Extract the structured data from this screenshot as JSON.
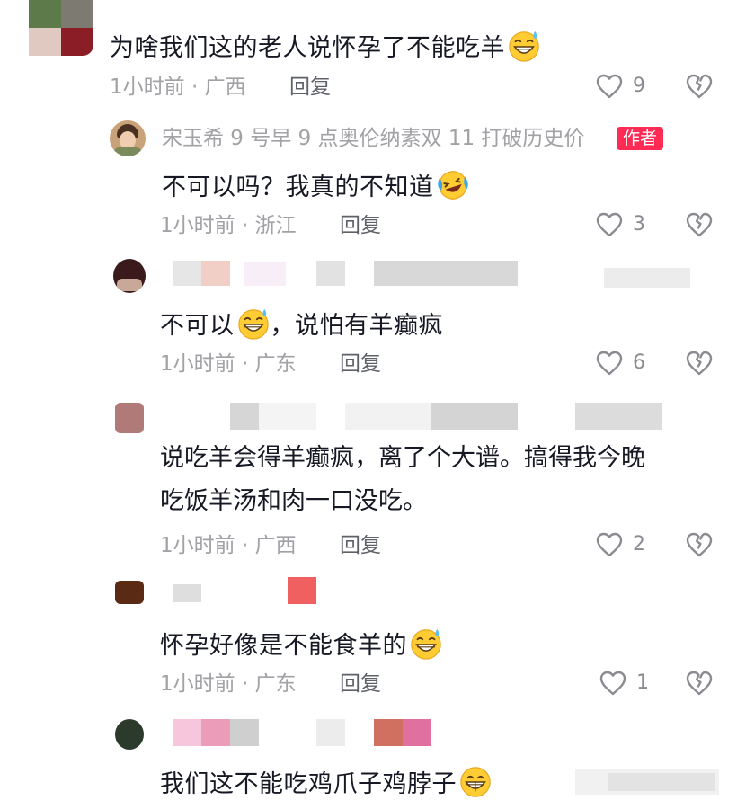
{
  "comments": [
    {
      "text": "为啥我们这的老人说怀孕了不能吃羊",
      "emoji": "grin-sweat-emoji",
      "meta": "1小时前 · 广西",
      "reply_label": "回复",
      "likes": "9"
    },
    {
      "author": "宋玉希 9 号早 9 点奥伦纳素双 11 打破历史价",
      "author_badge": "作者",
      "text": "不可以吗？我真的不知道",
      "emoji": "laugh-cry-emoji",
      "meta": "1小时前 · 浙江",
      "reply_label": "回复",
      "likes": "3"
    },
    {
      "text_before": "不可以",
      "emoji": "grin-sweat-emoji",
      "text_after": "，说怕有羊癫疯",
      "meta": "1小时前 · 广东",
      "reply_label": "回复",
      "likes": "6"
    },
    {
      "line1": "说吃羊会得羊癫疯，离了个大谱。搞得我今晚",
      "line2": "吃饭羊汤和肉一口没吃。",
      "meta": "1小时前 · 广西",
      "reply_label": "回复",
      "likes": "2"
    },
    {
      "text": "怀孕好像是不能食羊的",
      "emoji": "grin-sweat-emoji",
      "meta": "1小时前 · 广东",
      "reply_label": "回复",
      "likes": "1"
    },
    {
      "text": "我们这不能吃鸡爪子鸡脖子",
      "emoji": "grin-emoji"
    }
  ],
  "colors": {
    "badge": "#fe2c55",
    "meta": "#a1a1a6",
    "text": "#161823"
  }
}
